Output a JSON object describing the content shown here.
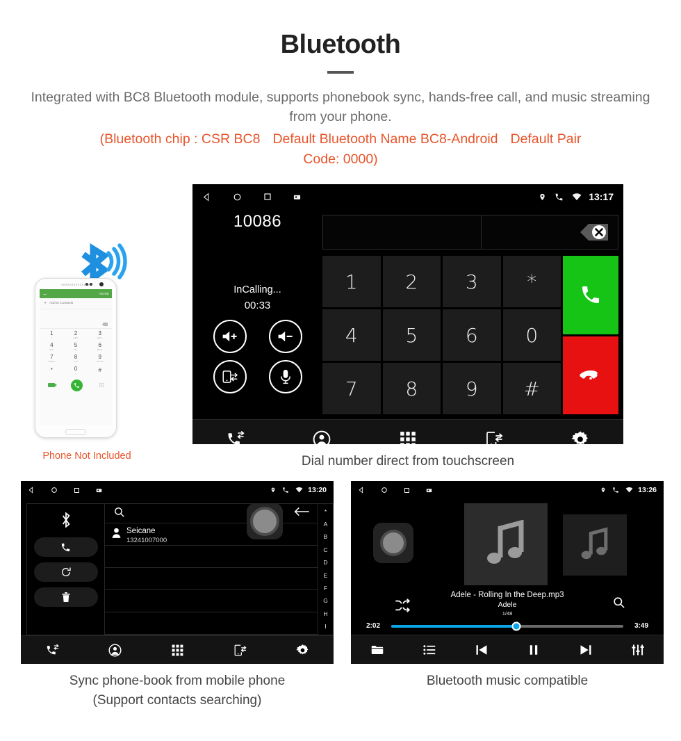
{
  "header": {
    "title": "Bluetooth",
    "subtitle": "Integrated with BC8 Bluetooth module, supports phonebook sync, hands-free call, and music streaming from your phone.",
    "note_line1_a": "(Bluetooth chip : CSR BC8",
    "note_line1_b": "Default Bluetooth Name BC8-Android",
    "note_line1_c": "Default Pair",
    "note_line2": "Code: 0000)",
    "note_color": "#e8542a"
  },
  "phone_mock": {
    "app_bar_more": "MORE",
    "add_to_contacts": "Add to Contacts",
    "keys": [
      {
        "n": "1",
        "s": "∞"
      },
      {
        "n": "2",
        "s": "ABC"
      },
      {
        "n": "3",
        "s": "DEF"
      },
      {
        "n": "4",
        "s": "GHI"
      },
      {
        "n": "5",
        "s": "JKL"
      },
      {
        "n": "6",
        "s": "MNO"
      },
      {
        "n": "7",
        "s": "PQRS"
      },
      {
        "n": "8",
        "s": "TUV"
      },
      {
        "n": "9",
        "s": "WXYZ"
      },
      {
        "n": "*",
        "s": ""
      },
      {
        "n": "0",
        "s": "+"
      },
      {
        "n": "#",
        "s": ""
      }
    ],
    "caption": "Phone Not Included",
    "caption_color": "#e8542a"
  },
  "dialer": {
    "status": {
      "time": "13:17",
      "icons_left": [
        "back-icon",
        "home-icon",
        "recents-icon",
        "screenshot-icon"
      ],
      "icons_right": [
        "location-icon",
        "phone-icon",
        "wifi-icon"
      ]
    },
    "dial_number": "10086",
    "call_state": "InCalling...",
    "call_time": "00:33",
    "input_value": "",
    "controls": [
      {
        "name": "volume-up-button",
        "label": "volume-up-icon"
      },
      {
        "name": "volume-down-button",
        "label": "volume-down-icon"
      },
      {
        "name": "transfer-call-button",
        "label": "phone-transfer-icon"
      },
      {
        "name": "mute-mic-button",
        "label": "microphone-icon"
      }
    ],
    "keys": [
      "1",
      "2",
      "3",
      "*",
      "4",
      "5",
      "6",
      "0",
      "7",
      "8",
      "9",
      "#"
    ],
    "call_button": "call-icon",
    "hangup_button": "hangup-icon",
    "call_color": "#16c416",
    "hangup_color": "#e81111",
    "tabs": [
      "call-history-icon",
      "contacts-icon",
      "keypad-icon",
      "phone-sync-icon",
      "settings-icon"
    ],
    "caption": "Dial number direct from touchscreen"
  },
  "phonebook": {
    "status": {
      "time": "13:20",
      "icons_left": [
        "back-icon",
        "home-icon",
        "recents-icon",
        "screenshot-icon"
      ],
      "icons_right": [
        "location-icon",
        "phone-icon",
        "wifi-icon"
      ]
    },
    "side_actions": [
      {
        "name": "bluetooth-status-icon",
        "label": "bluetooth-icon"
      },
      {
        "name": "dial-button",
        "label": "phone-icon"
      },
      {
        "name": "sync-contacts-button",
        "label": "sync-icon"
      },
      {
        "name": "delete-contacts-button",
        "label": "trash-icon"
      }
    ],
    "search_placeholder": "",
    "contacts": [
      {
        "name": "Seicane",
        "number": "13241007000"
      }
    ],
    "empty_rows": 4,
    "alpha_index": [
      "*",
      "A",
      "B",
      "C",
      "D",
      "E",
      "F",
      "G",
      "H",
      "I"
    ],
    "tabs": [
      "call-history-icon",
      "contacts-icon",
      "keypad-icon",
      "phone-sync-icon",
      "settings-icon"
    ],
    "caption_line1": "Sync phone-book from mobile phone",
    "caption_line2": "(Support contacts searching)"
  },
  "music": {
    "status": {
      "time": "13:26",
      "icons_left": [
        "back-icon",
        "home-icon",
        "recents-icon",
        "screenshot-icon"
      ],
      "icons_right": [
        "location-icon",
        "phone-icon",
        "wifi-icon"
      ]
    },
    "track": "Adele - Rolling In the Deep.mp3",
    "artist": "Adele",
    "track_index": "1/48",
    "elapsed": "2:02",
    "duration": "3:49",
    "progress_percent": 54,
    "progress_color": "#0aa6e8",
    "shuffle_icon": "shuffle-icon",
    "search_icon": "search-icon",
    "tabs": [
      "folder-icon",
      "playlist-icon",
      "previous-icon",
      "pause-icon",
      "next-icon",
      "equalizer-icon"
    ],
    "caption": "Bluetooth music compatible"
  }
}
